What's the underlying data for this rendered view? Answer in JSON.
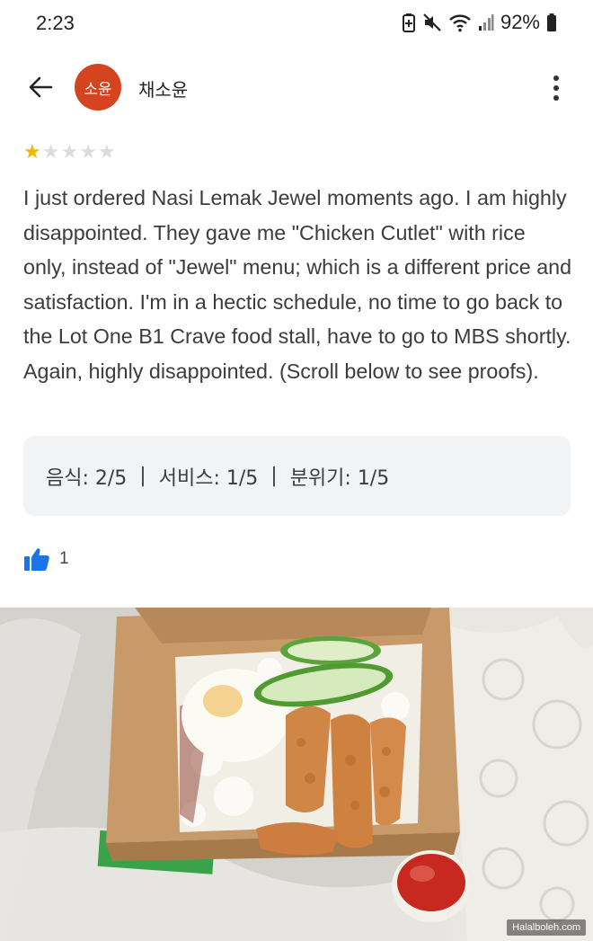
{
  "status_bar": {
    "time": "2:23",
    "battery": "92%",
    "icons": [
      "battery-saver-icon",
      "mute-icon",
      "wifi-icon",
      "signal-icon",
      "battery-icon"
    ]
  },
  "header": {
    "back_icon": "arrow-left-icon",
    "avatar_text": "소윤",
    "avatar_color": "#d4451f",
    "user_name": "채소윤",
    "more_icon": "more-vert-icon"
  },
  "review": {
    "rating": 1,
    "max_rating": 5,
    "star_color": "#f4b400",
    "text": "I just ordered Nasi Lemak Jewel moments ago. I am highly disappointed. They gave me \"Chicken Cutlet\" with rice only, instead of \"Jewel\" menu; which is a different price and satisfaction. I'm in a hectic schedule, no time to go back to the Lot One B1 Crave food stall, have to go to MBS shortly. Again, highly disappointed. (Scroll below to see proofs).",
    "subratings": [
      {
        "label": "음식",
        "value": "2/5"
      },
      {
        "label": "서비스",
        "value": "1/5"
      },
      {
        "label": "분위기",
        "value": "1/5"
      }
    ],
    "separator": "|",
    "likes": "1",
    "like_icon": "thumbs-up-icon",
    "like_color": "#1a73e8"
  },
  "photo": {
    "watermark": "Halalboleh.com"
  }
}
